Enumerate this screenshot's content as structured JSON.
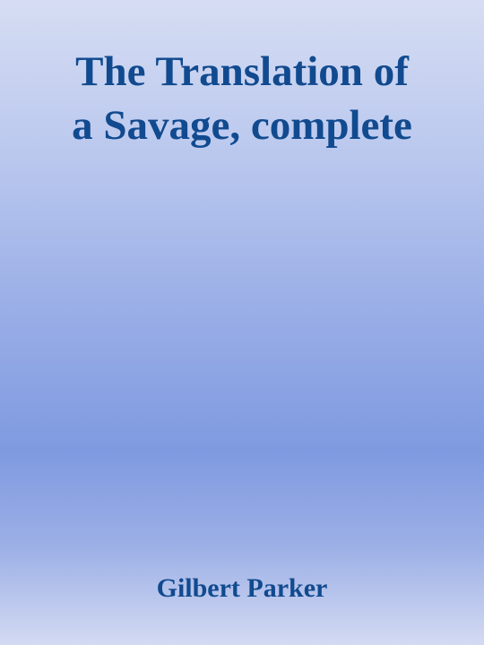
{
  "book": {
    "title_lines": [
      "The Translation of",
      "a Savage, complete"
    ],
    "author": "Gilbert Parker"
  }
}
